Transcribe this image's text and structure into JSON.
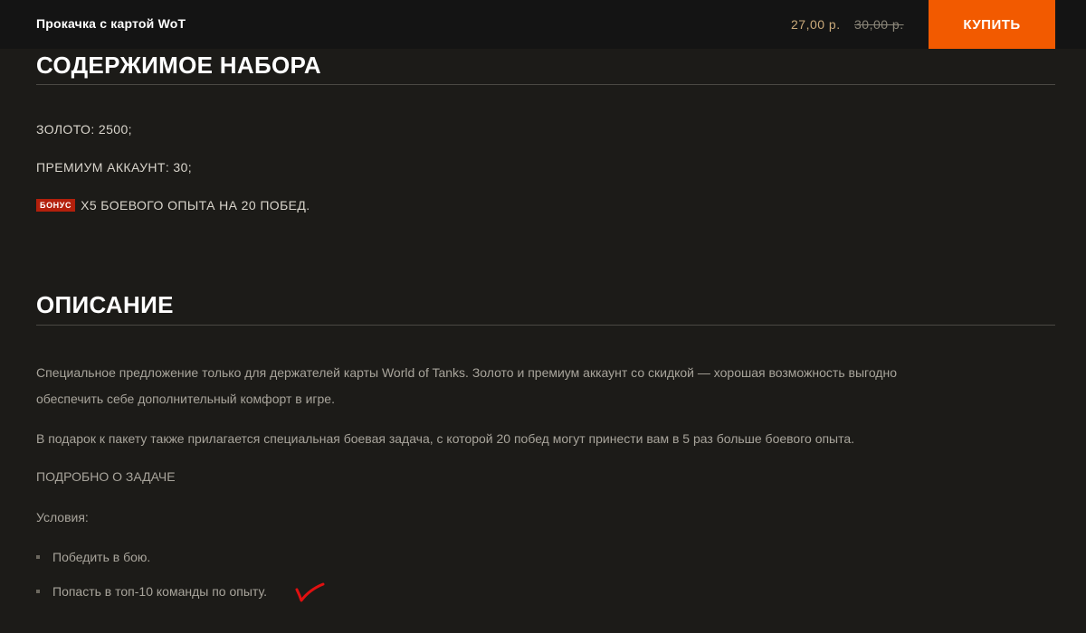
{
  "header": {
    "product_title": "Прокачка с картой WoT",
    "price_current": "27,00 р.",
    "price_old": "30,00 р.",
    "buy_label": "КУПИТЬ"
  },
  "contents": {
    "title": "СОДЕРЖИМОЕ НАБОРА",
    "items": [
      "ЗОЛОТО: 2500;",
      "ПРЕМИУМ АККАУНТ: 30;"
    ],
    "bonus_badge": "БОНУС",
    "bonus_text": "Х5 БОЕВОГО ОПЫТА НА 20 ПОБЕД."
  },
  "description": {
    "title": "ОПИСАНИЕ",
    "paragraph1": "Специальное предложение только для держателей карты World of Tanks. Золото и премиум аккаунт со скидкой — хорошая возможность выгодно обеспечить себе дополнительный комфорт в игре.",
    "paragraph2": "В подарок к пакету также прилагается специальная боевая задача, с которой 20 побед могут принести вам в 5 раз больше боевого опыта.",
    "task_heading": "ПОДРОБНО О ЗАДАЧЕ",
    "conditions_label": "Условия:",
    "conditions": [
      "Победить в бою.",
      "Попасть в топ-10 команды по опыту."
    ]
  },
  "colors": {
    "background": "#1c1b18",
    "accent": "#f25a00",
    "bonus": "#b3200c"
  }
}
